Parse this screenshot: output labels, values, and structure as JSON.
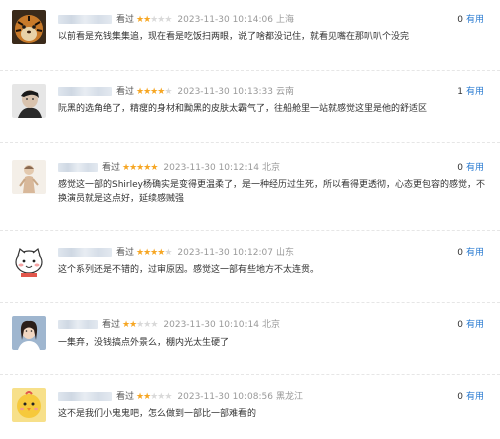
{
  "comments": [
    {
      "seen": "看过",
      "stars": 2,
      "time": "2023-11-30 10:14:06",
      "location": "上海",
      "useful_count": "0",
      "useful_label": "有用",
      "text": "以前看是充钱集集追，现在看是吃饭扫两眼，说了啥都没记住，就看见嘴在那叭叭个没完",
      "avatar": "tiger-avatar"
    },
    {
      "seen": "看过",
      "stars": 4,
      "time": "2023-11-30 10:13:33",
      "location": "云南",
      "useful_count": "1",
      "useful_label": "有用",
      "text": "阮黑的选角绝了，精瘦的身材和黝黑的皮肤太霸气了，往船舱里一站就感觉这里是他的舒适区",
      "avatar": "man-portrait-avatar"
    },
    {
      "seen": "看过",
      "stars": 5,
      "time": "2023-11-30 10:12:14",
      "location": "北京",
      "useful_count": "0",
      "useful_label": "有用",
      "text": "感觉这一部的Shirley杨确实是变得更温柔了，是一种经历过生死，所以看得更透彻，心态更包容的感觉，不换演员就是这点好，延续感贼强",
      "avatar": "sketch-figure-avatar"
    },
    {
      "seen": "看过",
      "stars": 4,
      "time": "2023-11-30 10:12:07",
      "location": "山东",
      "useful_count": "0",
      "useful_label": "有用",
      "text": "这个系列还是不错的，过审原因。感觉这一部有些地方不太连贯。",
      "avatar": "cartoon-cat-avatar"
    },
    {
      "seen": "看过",
      "stars": 2,
      "time": "2023-11-30 10:10:14",
      "location": "北京",
      "useful_count": "0",
      "useful_label": "有用",
      "text": "一集弃，没钱搞点外景么，棚内光太生硬了",
      "avatar": "woman-photo-avatar"
    },
    {
      "seen": "看过",
      "stars": 2,
      "time": "2023-11-30 10:08:56",
      "location": "黑龙江",
      "useful_count": "0",
      "useful_label": "有用",
      "text": "这不是我们小鬼鬼吧，怎么做到一部比一部难看的",
      "avatar": "chick-avatar"
    }
  ]
}
